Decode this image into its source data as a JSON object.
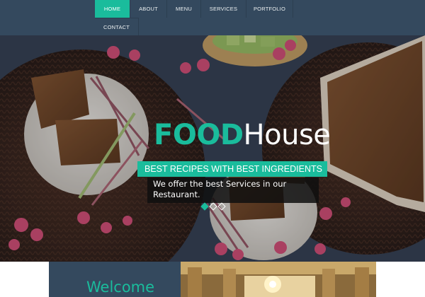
{
  "nav": {
    "items": [
      {
        "label": "HOME",
        "active": true
      },
      {
        "label": "ABOUT",
        "active": false
      },
      {
        "label": "MENU",
        "active": false
      },
      {
        "label": "SERVICES",
        "active": false
      },
      {
        "label": "PORTFOLIO",
        "active": false
      },
      {
        "label": "CONTACT",
        "active": false
      }
    ]
  },
  "hero": {
    "title_part1": "FOOD",
    "title_part2": "House",
    "tagline": "BEST RECIPES WITH BEST INGREDIENTS",
    "description": "We offer the best Services in our Restaurant.",
    "slides": {
      "count": 3,
      "active_index": 0
    }
  },
  "welcome": {
    "title": "Welcome"
  },
  "colors": {
    "accent": "#1abc9c",
    "nav_bg": "#34495e",
    "text_light": "#ffffff"
  }
}
